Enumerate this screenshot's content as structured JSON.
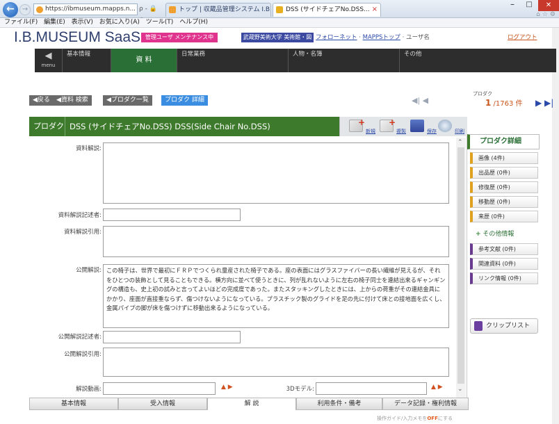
{
  "browser": {
    "address": "https://ibmuseum.mapps.n...",
    "address_tools": "ρ - 🔒 C",
    "tabs": [
      {
        "label": "トップ | 収蔵品管理システム I.B..."
      },
      {
        "label": "DSS (サイドチェアNo.DSS..."
      }
    ],
    "tab_close": "×",
    "menu": [
      "ファイル(F)",
      "編集(E)",
      "表示(V)",
      "お気に入り(A)",
      "ツール(T)",
      "ヘルプ(H)"
    ]
  },
  "header": {
    "logo": "I.B.MUSEUM SaaS",
    "maintenance_tag": "管理ユーザ メンテナンス中",
    "univ_tag": "武蔵野美術大学 美術館・図書館",
    "follow_link": "フォローネット",
    "mapps_link": "MAPPSトップ",
    "user_label": "ユーザ名",
    "logout": "ログアウト"
  },
  "nav": {
    "menu_label": "menu",
    "menu_arrow": "◀",
    "items": [
      {
        "label": "基本情報"
      },
      {
        "label": "資 料"
      },
      {
        "label": "日常業務"
      },
      {
        "label": "人物・名簿"
      },
      {
        "label": "その他"
      }
    ]
  },
  "breadcrumb": [
    {
      "label": "◀戻る"
    },
    {
      "label": "◀資料 検索"
    },
    {
      "label": "◀プロダク一覧"
    },
    {
      "label": "プロダク 詳細"
    }
  ],
  "pager": {
    "nav_first_prev": "◀| ◀",
    "label": "プロダク",
    "current": "1",
    "total": "/1763",
    "unit": "件",
    "nav_next_last": "▶ ▶|"
  },
  "record": {
    "type_label": "プロダク",
    "title": "DSS (サイドチェアNo.DSS)   DSS(Side Chair No.DSS)",
    "actions": [
      {
        "label": "新規"
      },
      {
        "label": "複製"
      },
      {
        "label": "保存"
      },
      {
        "label": "印刷"
      }
    ]
  },
  "side_panel": {
    "header": "プロダク詳細",
    "items_top": [
      {
        "label": "画像 (4件)"
      },
      {
        "label": "出品歴 (0件)"
      },
      {
        "label": "修復歴 (0件)"
      },
      {
        "label": "移動歴 (0件)"
      },
      {
        "label": "来歴 (0件)"
      }
    ],
    "other_info": "その他情報",
    "other_plus": "+",
    "items_bottom": [
      {
        "label": "参考文献 (0件)"
      },
      {
        "label": "関連資料 (0件)"
      },
      {
        "label": "リンク情報 (0件)"
      }
    ],
    "clip_list": "クリップリスト"
  },
  "form": {
    "fields": [
      {
        "label": "資料解説:",
        "value": ""
      },
      {
        "label": "資料解説記述者:",
        "value": ""
      },
      {
        "label": "資料解説引用:",
        "value": ""
      },
      {
        "label": "公開解説:",
        "value": "この椅子は、世界で最初にＦＲＰでつくられ量産された椅子である。座の表面にはグラスファイバーの長い繊維が見えるが、それをひとつの装飾として見ることもできる。横方向に並べて使うときに、列が乱れないように左右の椅子同士を連結出来るギャンギングの構造も、史上初の試みと言ってよいほどの完成度であった。またスタッキングしたときには、上からの荷重がその連結金具にかかり、座面が直接重ならず、傷つけないようになっている。プラスチック製のグライドを足の先に付けて床との接地面を広くし、金属パイプの脚が床を傷つけずに移動出来るようになっている。"
      },
      {
        "label": "公開解説記述者:",
        "value": ""
      },
      {
        "label": "公開解説引用:",
        "value": ""
      },
      {
        "label": "解説動画:",
        "value": ""
      },
      {
        "label": "3Dモデル:",
        "value": ""
      }
    ],
    "file_icons": "▲ ▶"
  },
  "bottom_tabs": [
    {
      "label": "基本情報"
    },
    {
      "label": "受入情報"
    },
    {
      "label": "解 説"
    },
    {
      "label": "利用条件・備考"
    },
    {
      "label": "データ記録・権利情報"
    }
  ],
  "footer": {
    "note_pre": "操作ガイド/入力メモを",
    "note_off": "OFF",
    "note_post": "にする"
  },
  "colors": {
    "nav_dark": "#2d2d2d",
    "title_green": "#3d7a2c",
    "maint_pink": "#e0338e",
    "univ_blue": "#3b4aa0",
    "crumb_active": "#3a8de0",
    "link_orange": "#c8541b"
  }
}
